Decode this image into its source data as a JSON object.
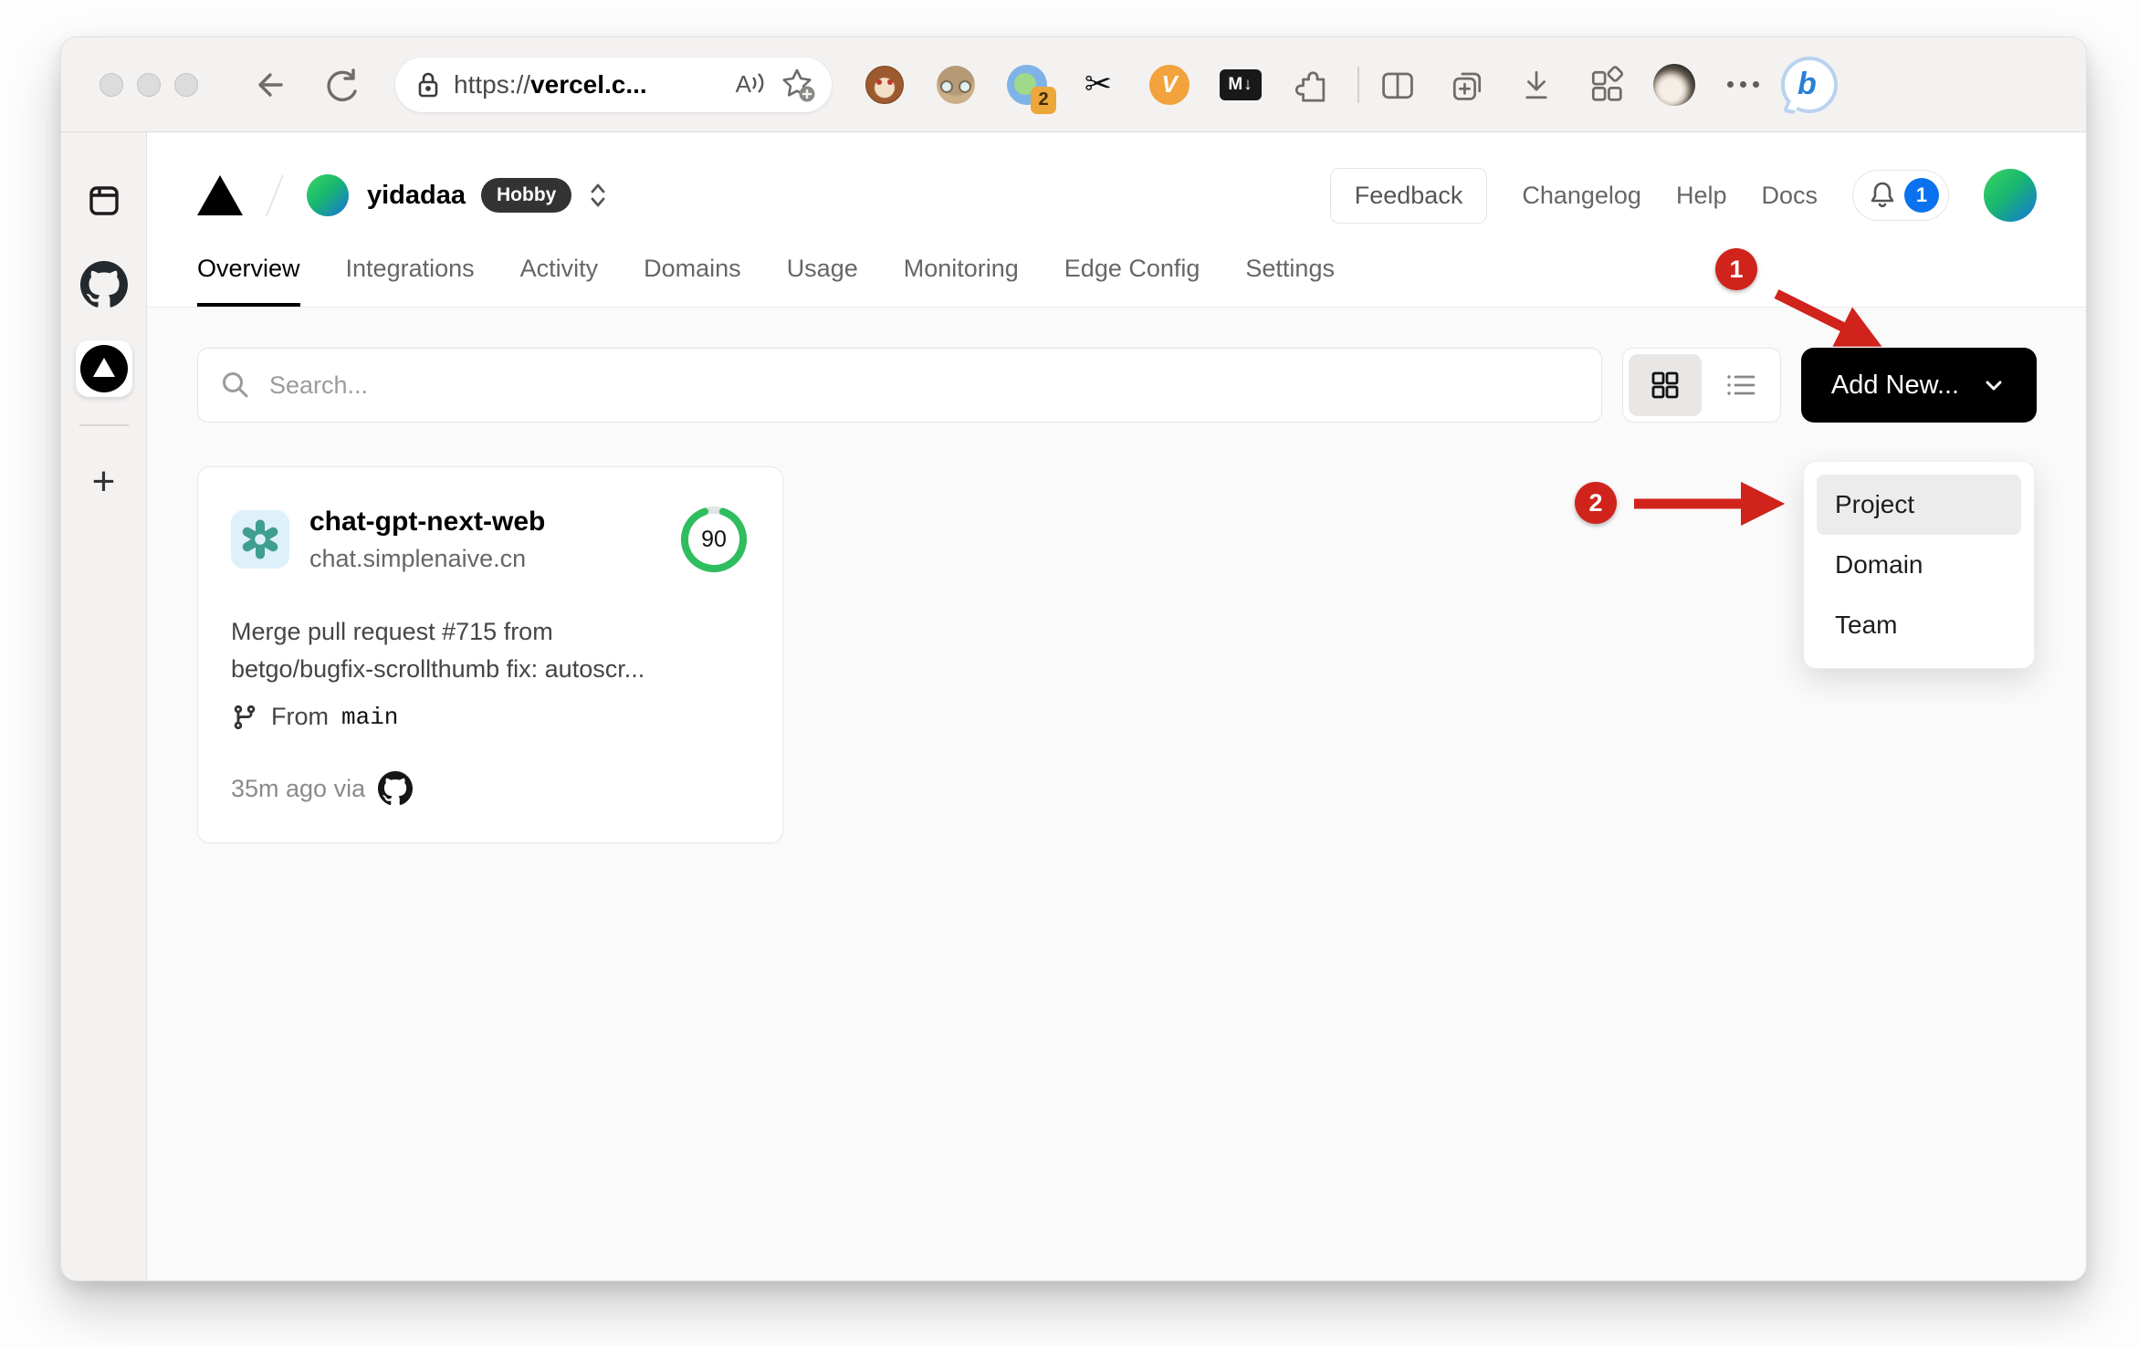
{
  "browser": {
    "url": {
      "scheme": "https://",
      "host": "vercel.c..."
    },
    "readaloud_glyph": "A",
    "extensions": {
      "translate_badge": "2",
      "scissors_glyph": "✂",
      "v_label": "V",
      "md_label": "M↓"
    },
    "bing_glyph": "b"
  },
  "site": {
    "scope_name": "yidadaa",
    "plan_badge": "Hobby",
    "feedback": "Feedback",
    "links": [
      "Changelog",
      "Help",
      "Docs"
    ],
    "notification_count": "1",
    "tabs": [
      "Overview",
      "Integrations",
      "Activity",
      "Domains",
      "Usage",
      "Monitoring",
      "Edge Config",
      "Settings"
    ]
  },
  "controls": {
    "search_placeholder": "Search...",
    "add_new": "Add New..."
  },
  "dropdown": {
    "items": [
      "Project",
      "Domain",
      "Team"
    ]
  },
  "project": {
    "name": "chat-gpt-next-web",
    "domain": "chat.simplenaive.cn",
    "score": "90",
    "commit_lines": [
      "Merge pull request #715 from",
      "betgo/bugfix-scrollthumb fix: autoscr..."
    ],
    "from_label": "From",
    "branch": "main",
    "meta": "35m ago via"
  },
  "annotations": {
    "step1": "1",
    "step2": "2"
  },
  "colors": {
    "annotation_red": "#d0231c",
    "score_green": "#2fbe5f",
    "notification_blue": "#0b72ef"
  }
}
